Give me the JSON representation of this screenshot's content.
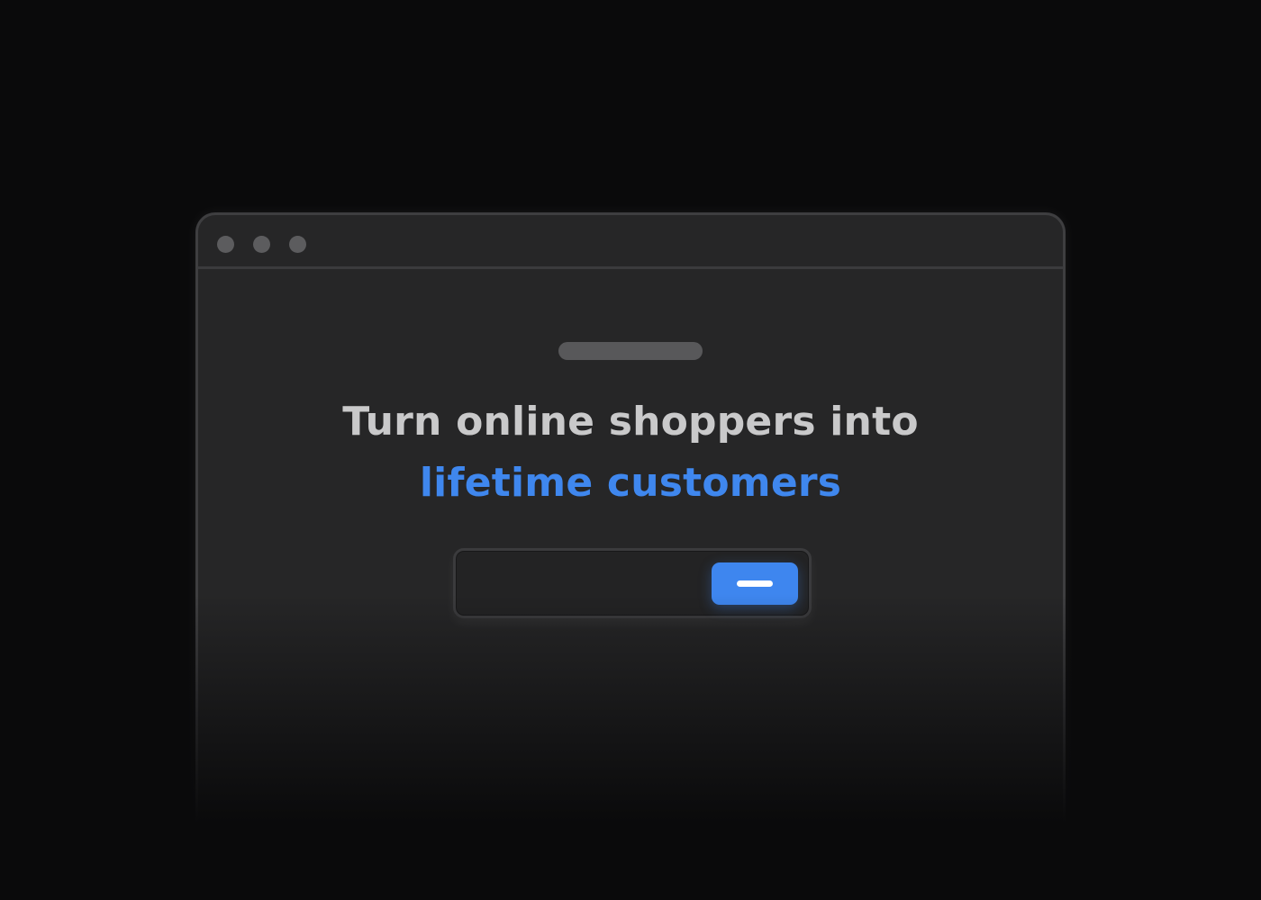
{
  "window": {
    "traffic_lights": [
      "window-dot-icon",
      "window-dot-icon",
      "window-dot-icon"
    ]
  },
  "hero": {
    "headline_line_1": "Turn online shoppers into",
    "headline_line_2": "lifetime customers"
  },
  "form": {
    "input_value": "",
    "submit_icon": "dash-icon"
  },
  "colors": {
    "background": "#0a0a0b",
    "window": "#262627",
    "accent": "#3e86ef",
    "headline": "#c9c9ca"
  }
}
